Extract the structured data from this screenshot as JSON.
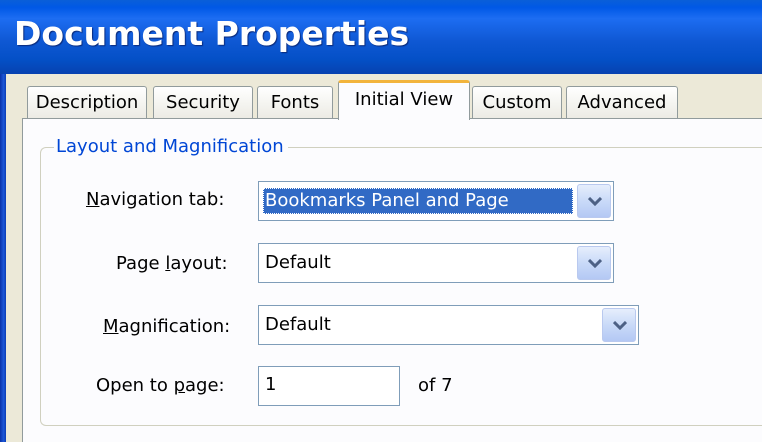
{
  "window": {
    "title": "Document Properties"
  },
  "tabs": [
    {
      "label": "Description",
      "active": false
    },
    {
      "label": "Security",
      "active": false
    },
    {
      "label": "Fonts",
      "active": false
    },
    {
      "label": "Initial View",
      "active": true
    },
    {
      "label": "Custom",
      "active": false
    },
    {
      "label": "Advanced",
      "active": false
    }
  ],
  "layout_group": {
    "legend": "Layout and Magnification",
    "navigation_tab": {
      "label_first": "N",
      "label_rest": "avigation tab:",
      "value": "Bookmarks Panel and Page"
    },
    "page_layout": {
      "label_pre": "Page ",
      "label_accel": "l",
      "label_post": "ayout:",
      "value": "Default"
    },
    "magnification": {
      "label_first": "M",
      "label_rest": "agnification:",
      "value": "Default"
    },
    "open_to_page": {
      "label_pre": "Open to ",
      "label_accel": "p",
      "label_post": "age:",
      "value": "1",
      "of_text": "of 7"
    }
  },
  "icons": {
    "dropdown": "chevron-down-icon"
  },
  "colors": {
    "titlebar": "#0058e6",
    "legend_text": "#0046d5",
    "selection": "#316ac5",
    "active_tab_accent": "#f2b43c"
  }
}
